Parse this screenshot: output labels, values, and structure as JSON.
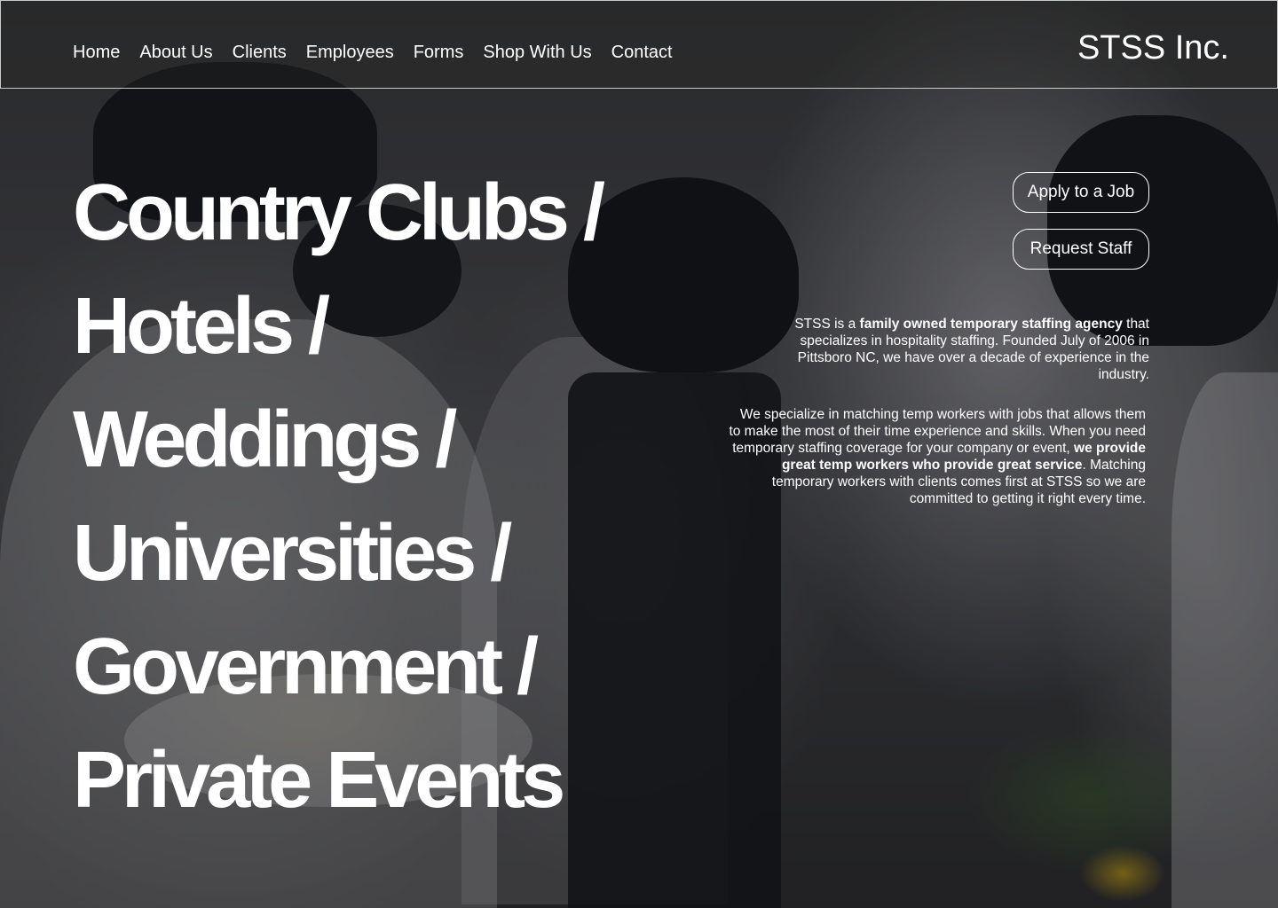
{
  "header": {
    "nav": [
      "Home",
      "About Us",
      "Clients",
      "Employees",
      "Forms",
      "Shop With Us",
      "Contact"
    ],
    "brand": "STSS Inc."
  },
  "hero": {
    "headline_lines": [
      "Country Clubs /",
      "Hotels /",
      "Weddings /",
      "Universities /",
      "Government /",
      "Private Events"
    ],
    "buttons": {
      "apply": "Apply to a Job",
      "request": "Request Staff"
    },
    "intro": {
      "before": "STSS is a ",
      "bold": "family owned temporary staffing agency",
      "after": " that specializes in hospitality staffing. Founded July of 2006 in Pittsboro NC, we have over a decade of experience in the industry."
    },
    "about": {
      "before": "We specialize in matching temp workers with jobs that allows them to make the most of their time experience and skills. When you need temporary staffing coverage for your company or event, ",
      "bold": "we provide great temp workers who provide great service",
      "after": ". Matching temporary workers with clients comes first at STSS so we are committed to getting it right every time."
    }
  },
  "colors": {
    "text": "#ffffff",
    "overlay": "#121216",
    "header_border": "#ffffff"
  }
}
